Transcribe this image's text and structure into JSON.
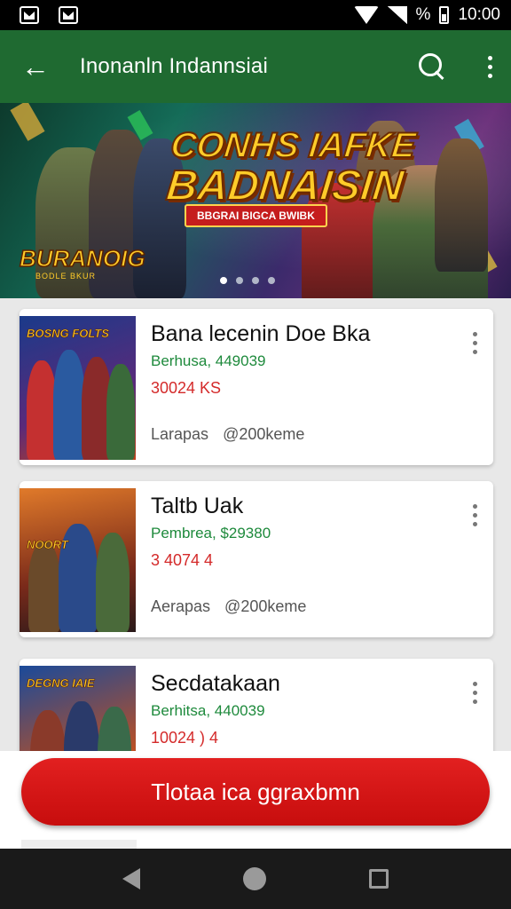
{
  "status_bar": {
    "battery_text": "%",
    "time": "10:00"
  },
  "app_bar": {
    "title": "Inonanln Indannsiai",
    "back_icon": "arrow-left-icon",
    "search_icon": "search-icon",
    "more_icon": "more-vert-icon"
  },
  "banner": {
    "headline_line1": "CONHS IAFKE",
    "headline_line2": "BADNAISIN",
    "subtag": "BBGRAI BIGCA BWIBK",
    "logo": "BURANOIG",
    "logo_sub": "BODLE BKUR",
    "slides": 4,
    "active_slide": 0
  },
  "items": [
    {
      "title": "Bana lecenin Doe Bka",
      "meta": "Berhusa, 449039",
      "price": "30024 KS",
      "footer_left": "Larapas",
      "footer_right": "@200keme",
      "thumb_title": "BOSNG FOLTS"
    },
    {
      "title": "Taltb Uak",
      "meta": "Pembrea, $29380",
      "price": "3 4074  4",
      "footer_left": "Aerapas",
      "footer_right": "@200keme",
      "thumb_title": "NOORT"
    },
    {
      "title": "Secdatakaan",
      "meta": "Berhitsa, 440039",
      "price": "10024 ) 4",
      "footer_left": "",
      "footer_right": "",
      "thumb_title": "DEGNG IAIE"
    }
  ],
  "cta": {
    "label": "Tlotaa ica ggraxbmn",
    "color": "#d71616"
  },
  "colors": {
    "app_bar": "#1f6a31",
    "meta_green": "#1e8a3c",
    "price_red": "#d42a2a"
  }
}
